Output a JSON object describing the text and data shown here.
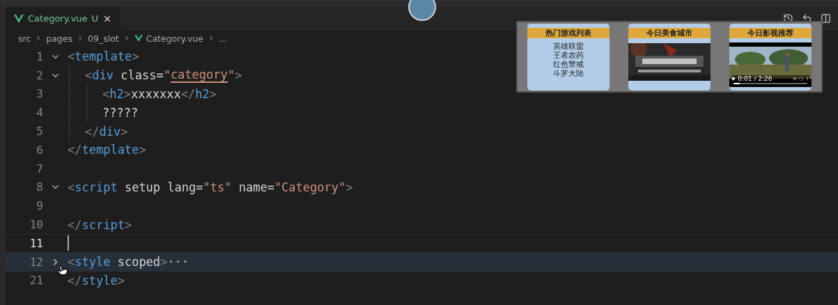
{
  "tab": {
    "label": "Category.vue",
    "status": "U",
    "selected": true
  },
  "breadcrumb": [
    "src",
    "pages",
    "09_slot",
    "Category.vue",
    "..."
  ],
  "lines": [
    {
      "number": "1",
      "expanded": true,
      "tokens": [
        {
          "kind": "punct",
          "text": "<"
        },
        {
          "kind": "tag",
          "text": "template"
        },
        {
          "kind": "punct",
          "text": ">"
        }
      ],
      "children": [
        {
          "number": "2",
          "expanded": true,
          "tokens": [
            {
              "kind": "punct",
              "text": "<"
            },
            {
              "kind": "tag",
              "text": "div"
            },
            {
              "kind": "plain",
              "text": " class="
            },
            {
              "kind": "string",
              "text": "\""
            },
            {
              "kind": "string",
              "text": "category",
              "underlined": true
            },
            {
              "kind": "string",
              "text": "\""
            },
            {
              "kind": "punct",
              "text": ">"
            }
          ],
          "children": [
            {
              "number": "3",
              "tokens": [
                {
                  "kind": "punct",
                  "text": "<"
                },
                {
                  "kind": "tag",
                  "text": "h2"
                },
                {
                  "kind": "punct",
                  "text": ">"
                },
                {
                  "kind": "plain",
                  "text": "xxxxxxx"
                },
                {
                  "kind": "punct",
                  "text": "</"
                },
                {
                  "kind": "tag",
                  "text": "h2"
                },
                {
                  "kind": "punct",
                  "text": ">"
                }
              ]
            },
            {
              "number": "4",
              "tokens": [
                {
                  "kind": "plain",
                  "text": "?????"
                }
              ]
            }
          ]
        },
        {
          "number": "5",
          "tokens": [
            {
              "kind": "punct",
              "text": "</"
            },
            {
              "kind": "tag",
              "text": "div"
            },
            {
              "kind": "punct",
              "text": ">"
            }
          ]
        }
      ]
    },
    {
      "number": "6",
      "tokens": [
        {
          "kind": "punct",
          "text": "</"
        },
        {
          "kind": "tag",
          "text": "template"
        },
        {
          "kind": "punct",
          "text": ">"
        }
      ]
    },
    {
      "number": "7"
    },
    {
      "number": "8",
      "expanded": true,
      "tokens": [
        {
          "kind": "punct",
          "text": "<"
        },
        {
          "kind": "tag",
          "text": "script"
        },
        {
          "kind": "plain",
          "text": " setup lang="
        },
        {
          "kind": "string",
          "text": "\"ts\""
        },
        {
          "kind": "plain",
          "text": " name="
        },
        {
          "kind": "string",
          "text": "\"Category\""
        },
        {
          "kind": "punct",
          "text": ">"
        }
      ]
    },
    {
      "number": "9"
    },
    {
      "number": "10",
      "tokens": [
        {
          "kind": "punct",
          "text": "</"
        },
        {
          "kind": "tag",
          "text": "script"
        },
        {
          "kind": "punct",
          "text": ">"
        }
      ]
    },
    {
      "number": "11",
      "current": true
    },
    {
      "number": "12",
      "expanded": false,
      "highlighted": true,
      "tokens": [
        {
          "kind": "punct",
          "text": "<"
        },
        {
          "kind": "tag",
          "text": "style"
        },
        {
          "kind": "plain",
          "text": " scoped"
        },
        {
          "kind": "punct",
          "text": ">"
        },
        {
          "kind": "ellipsis",
          "text": "···"
        }
      ]
    },
    {
      "number": "21",
      "tokens": [
        {
          "kind": "punct",
          "text": "</"
        },
        {
          "kind": "tag",
          "text": "style"
        },
        {
          "kind": "punct",
          "text": ">"
        }
      ]
    }
  ],
  "preview": {
    "cards": [
      {
        "title": "热门游戏列表",
        "kind": "list",
        "items": [
          "英雄联盟",
          "王者农药",
          "红色警戒",
          "斗罗大陆"
        ]
      },
      {
        "title": "今日美食城市",
        "kind": "picture"
      },
      {
        "title": "今日影视推荐",
        "kind": "video",
        "time": "0:01 / 2:26",
        "level": 0.08
      }
    ]
  }
}
